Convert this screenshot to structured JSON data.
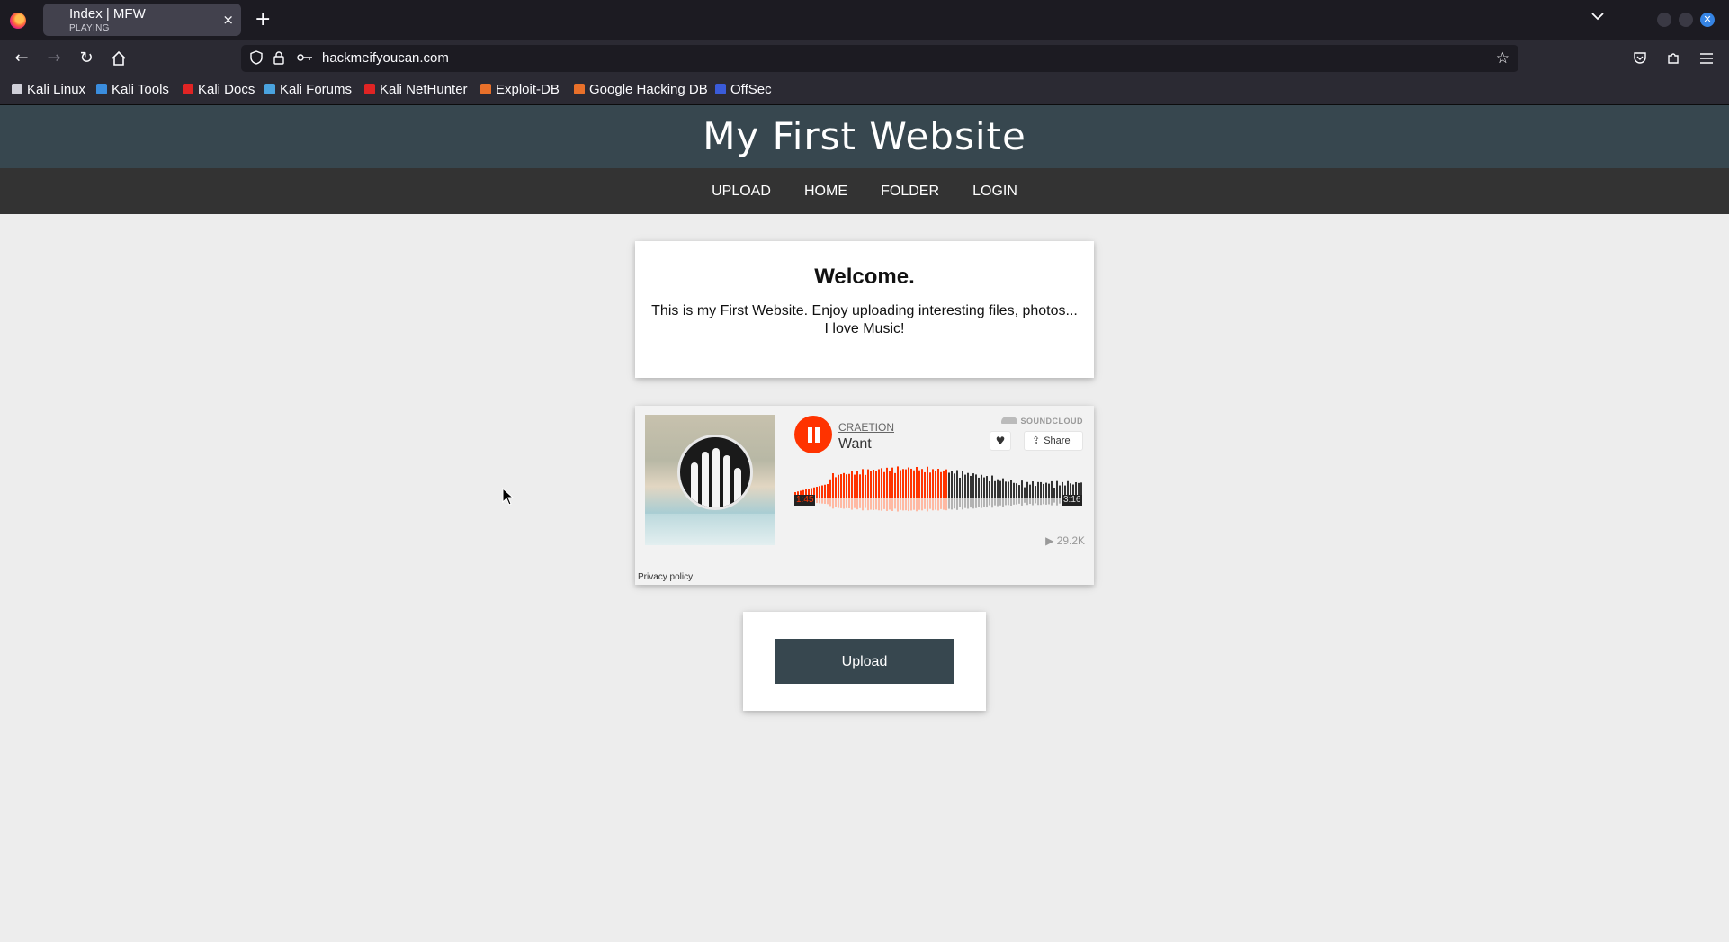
{
  "browser": {
    "tab": {
      "title": "Index | MFW",
      "status": "PLAYING",
      "close": "×"
    },
    "new_tab": "+",
    "url": "hackmeifyoucan.com",
    "bookmarks": [
      {
        "label": "Kali Linux",
        "color": "#ffffff"
      },
      {
        "label": "Kali Tools",
        "color": "#3a8dde"
      },
      {
        "label": "Kali Docs",
        "color": "#e02424"
      },
      {
        "label": "Kali Forums",
        "color": "#4aa3df"
      },
      {
        "label": "Kali NetHunter",
        "color": "#e02424"
      },
      {
        "label": "Exploit-DB",
        "color": "#e8702a"
      },
      {
        "label": "Google Hacking DB",
        "color": "#e8702a"
      },
      {
        "label": "OffSec",
        "color": "#3a5bd9"
      }
    ]
  },
  "site": {
    "title": "My First Website",
    "nav": [
      "UPLOAD",
      "HOME",
      "FOLDER",
      "LOGIN"
    ],
    "welcome": {
      "heading": "Welcome.",
      "text": "This is my First Website. Enjoy uploading interesting files, photos... I love Music!"
    },
    "player": {
      "artist": "CRAETION",
      "track": "Want",
      "brand": "SOUNDCLOUD",
      "share_label": "Share",
      "current_time": "1:45",
      "duration": "3:16",
      "progress_fraction": 0.535,
      "plays": "29.2K",
      "privacy": "Privacy policy",
      "accent_color": "#ff3300"
    },
    "upload_button": "Upload"
  }
}
